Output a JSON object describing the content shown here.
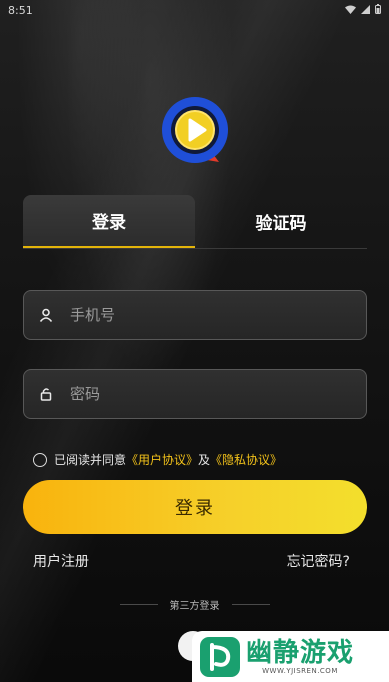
{
  "status_bar": {
    "time": "8:51"
  },
  "tabs": [
    {
      "label": "登录",
      "active": true
    },
    {
      "label": "验证码",
      "active": false
    }
  ],
  "phone_field": {
    "placeholder": "手机号",
    "value": "",
    "icon": "user-icon"
  },
  "password_field": {
    "placeholder": "密码",
    "value": "",
    "icon": "lock-icon"
  },
  "agreement": {
    "prefix": "已阅读并同意",
    "user_agreement": "《用户协议》",
    "conjunction": "及",
    "privacy_policy": "《隐私协议》",
    "checked": false
  },
  "login_button": {
    "label": "登录"
  },
  "links": {
    "register": "用户注册",
    "forgot_password": "忘记密码?"
  },
  "third_party": {
    "label": "第三方登录"
  },
  "watermark": {
    "title": "幽静游戏",
    "url": "WWW.YJISREN.COM"
  },
  "colors": {
    "accent": "#f3c21a",
    "button_start": "#f9b30d",
    "button_end": "#f3df2c",
    "background": "#121212",
    "watermark_green": "#1aa06f"
  }
}
